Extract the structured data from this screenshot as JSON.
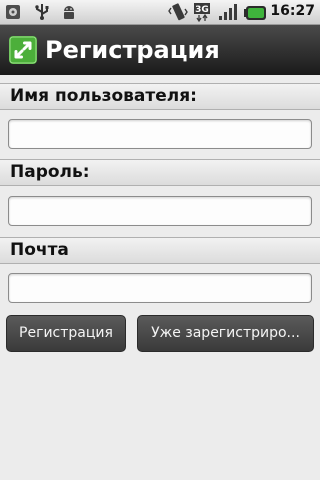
{
  "status_bar": {
    "time": "16:27",
    "network": "3G",
    "icons": [
      "hdd-icon",
      "usb-icon",
      "android-debug-icon",
      "vibrate-icon",
      "network-3g-icon",
      "signal-icon",
      "battery-icon"
    ]
  },
  "app": {
    "title": "Регистрация",
    "icon": "app-arrows-icon"
  },
  "form": {
    "username_label": "Имя пользователя:",
    "username_value": "",
    "password_label": "Пароль:",
    "password_value": "",
    "email_label": "Почта",
    "email_value": ""
  },
  "buttons": {
    "register_label": "Регистрация",
    "already_registered_label": "Уже зарегистриро..."
  },
  "colors": {
    "title_bar": "#2e2e2e",
    "background": "#ececec",
    "battery": "#3fb43c",
    "button": "#4a4a4a"
  }
}
